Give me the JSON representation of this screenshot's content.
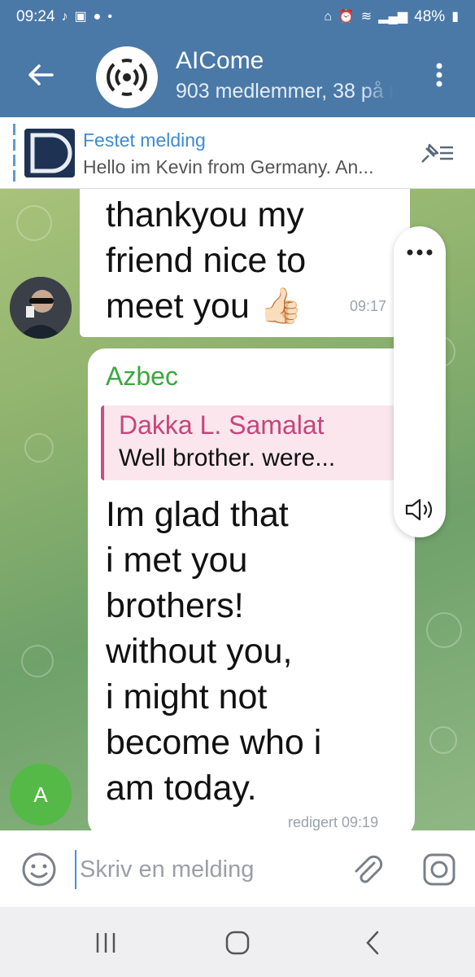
{
  "status_bar": {
    "time": "09:24",
    "battery": "48%",
    "left_icons": [
      "tiktok-icon",
      "gallery-icon",
      "messages-icon",
      "dot-icon"
    ],
    "right_icons": [
      "lock-icon",
      "alarm-icon",
      "wifi-icon",
      "signal-icon",
      "battery-icon"
    ]
  },
  "header": {
    "title": "AICome",
    "subtitle": "903 medlemmer, 38 på n",
    "back_icon": "arrow-left-icon",
    "menu_icon": "more-vertical-icon"
  },
  "pinned": {
    "title": "Festet melding",
    "text": "Hello im Kevin from Germany. An...",
    "close_icon": "unpin-list-icon"
  },
  "messages": [
    {
      "lines": [
        "thankyou my",
        "friend nice to",
        "meet you 👍🏻"
      ],
      "time": "09:17"
    },
    {
      "sender": "Azbec",
      "reply_to": {
        "name": "Dakka L. Samalat",
        "text": "Well brother. were..."
      },
      "lines": [
        "Im glad that",
        "i met you",
        "brothers!",
        "without you,",
        "i might not",
        "become who i",
        "am today."
      ],
      "time": "redigert 09:19"
    }
  ],
  "avatar_initial": "A",
  "input": {
    "placeholder": "Skriv en melding",
    "value": ""
  },
  "colors": {
    "header": "#4a79a8",
    "link": "#3d8bd0",
    "sender_green": "#3aa83f",
    "reply_pink": "#c6457a"
  }
}
